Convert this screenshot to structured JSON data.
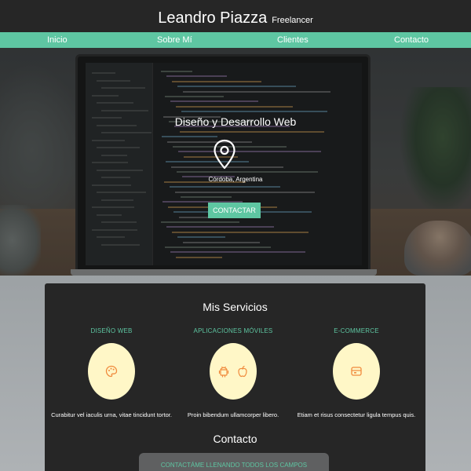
{
  "header": {
    "name": "Leandro Piazza",
    "tagline": "Freelancer"
  },
  "nav": {
    "items": [
      {
        "label": "Inicio"
      },
      {
        "label": "Sobre Mí"
      },
      {
        "label": "Clientes"
      },
      {
        "label": "Contacto"
      }
    ]
  },
  "hero": {
    "title": "Diseño y Desarrollo Web",
    "location": "Córdoba, Argentina",
    "location_icon": "map-pin-icon",
    "cta_label": "CONTACTAR"
  },
  "services": {
    "title": "Mis Servicios",
    "items": [
      {
        "name": "DISEÑO WEB",
        "description": "Curabitur vel iaculis urna, vitae tincidunt tortor.",
        "icon": "palette-icon"
      },
      {
        "name": "APLICACIONES MÓVILES",
        "description": "Proin bibendum ullamcorper libero.",
        "icon": "android-apple-icons"
      },
      {
        "name": "E-COMMERCE",
        "description": "Etiam et risus consectetur ligula tempus quis.",
        "icon": "wallet-icon"
      }
    ]
  },
  "contact": {
    "title": "Contacto",
    "form_title": "CONTACTÁME LLENANDO TODOS LOS CAMPOS"
  },
  "colors": {
    "accent": "#5ec6a2",
    "header_bg": "#262626",
    "service_circle": "#fff7c7",
    "icon_orange": "#f08a3c"
  }
}
